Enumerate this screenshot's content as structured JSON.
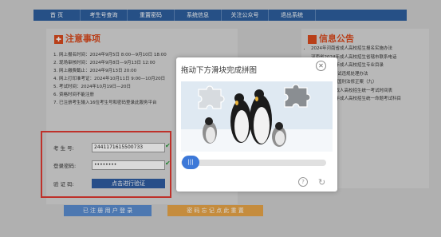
{
  "nav": {
    "items": [
      "首 页",
      "考生号查询",
      "重置密码",
      "系统信息",
      "关注公众号",
      "退出系统"
    ]
  },
  "notice": {
    "title": "注意事项",
    "items": [
      "网上报名时间：2024年9月5日 8:00—9月10日 18:00",
      "现场审核时间：2024年9月8日—9月13日 12:00",
      "网上缴费截止：2024年9月13日 20:00",
      "网上打印准考证：2024年10月11日 9:00—10月20日",
      "考试时间：2024年10月19日—20日",
      "资格时间不能注册",
      "已注册考生输入16位考生号和密码登录此服务平台"
    ]
  },
  "login": {
    "examno_label": "考 生 号:",
    "examno_value": "2441171615500733",
    "password_label": "登录密码:",
    "password_value": "••••••••",
    "captcha_label": "验 证 码:",
    "captcha_button": "点击进行验证",
    "registered_button": "已 注 册 用 户 登 录",
    "reset_button": "密 码 忘 记 点 此 重 置"
  },
  "news": {
    "title": "信息公告",
    "items": [
      "2024年河南省成人高校招生报名实施办法",
      "河南省2024年成人高校招生省辖市联系电话",
      "河南省2024年成人高校招生专业目录",
      "全国成人高考试违规处理办法",
      "中华人民共和国刑法修正案（九）",
      "2024年全国成人高校招生统一考试时间表",
      "河南省2024年成人高校招生统一命题考试科目"
    ]
  },
  "captcha_modal": {
    "title": "拖动下方滑块完成拼图",
    "close_icon": "close-icon",
    "handle_label": "|||",
    "help_icon": "?",
    "refresh_icon": "↻"
  }
}
